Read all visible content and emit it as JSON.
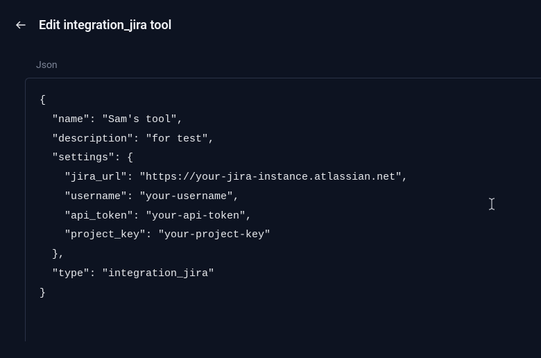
{
  "header": {
    "title": "Edit integration_jira tool"
  },
  "section": {
    "label": "Json"
  },
  "editor": {
    "content": "{\n  \"name\": \"Sam's tool\",\n  \"description\": \"for test\",\n  \"settings\": {\n    \"jira_url\": \"https://your-jira-instance.atlassian.net\",\n    \"username\": \"your-username\",\n    \"api_token\": \"your-api-token\",\n    \"project_key\": \"your-project-key\"\n  },\n  \"type\": \"integration_jira\"\n}"
  }
}
